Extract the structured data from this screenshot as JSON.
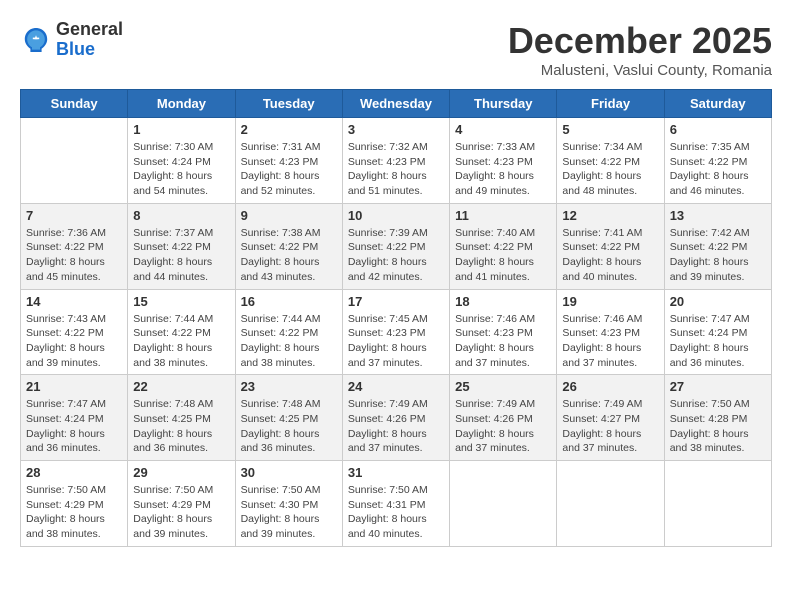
{
  "logo": {
    "general": "General",
    "blue": "Blue"
  },
  "header": {
    "month": "December 2025",
    "location": "Malusteni, Vaslui County, Romania"
  },
  "weekdays": [
    "Sunday",
    "Monday",
    "Tuesday",
    "Wednesday",
    "Thursday",
    "Friday",
    "Saturday"
  ],
  "weeks": [
    [
      {
        "day": "",
        "sunrise": "",
        "sunset": "",
        "daylight": ""
      },
      {
        "day": "1",
        "sunrise": "Sunrise: 7:30 AM",
        "sunset": "Sunset: 4:24 PM",
        "daylight": "Daylight: 8 hours and 54 minutes."
      },
      {
        "day": "2",
        "sunrise": "Sunrise: 7:31 AM",
        "sunset": "Sunset: 4:23 PM",
        "daylight": "Daylight: 8 hours and 52 minutes."
      },
      {
        "day": "3",
        "sunrise": "Sunrise: 7:32 AM",
        "sunset": "Sunset: 4:23 PM",
        "daylight": "Daylight: 8 hours and 51 minutes."
      },
      {
        "day": "4",
        "sunrise": "Sunrise: 7:33 AM",
        "sunset": "Sunset: 4:23 PM",
        "daylight": "Daylight: 8 hours and 49 minutes."
      },
      {
        "day": "5",
        "sunrise": "Sunrise: 7:34 AM",
        "sunset": "Sunset: 4:22 PM",
        "daylight": "Daylight: 8 hours and 48 minutes."
      },
      {
        "day": "6",
        "sunrise": "Sunrise: 7:35 AM",
        "sunset": "Sunset: 4:22 PM",
        "daylight": "Daylight: 8 hours and 46 minutes."
      }
    ],
    [
      {
        "day": "7",
        "sunrise": "Sunrise: 7:36 AM",
        "sunset": "Sunset: 4:22 PM",
        "daylight": "Daylight: 8 hours and 45 minutes."
      },
      {
        "day": "8",
        "sunrise": "Sunrise: 7:37 AM",
        "sunset": "Sunset: 4:22 PM",
        "daylight": "Daylight: 8 hours and 44 minutes."
      },
      {
        "day": "9",
        "sunrise": "Sunrise: 7:38 AM",
        "sunset": "Sunset: 4:22 PM",
        "daylight": "Daylight: 8 hours and 43 minutes."
      },
      {
        "day": "10",
        "sunrise": "Sunrise: 7:39 AM",
        "sunset": "Sunset: 4:22 PM",
        "daylight": "Daylight: 8 hours and 42 minutes."
      },
      {
        "day": "11",
        "sunrise": "Sunrise: 7:40 AM",
        "sunset": "Sunset: 4:22 PM",
        "daylight": "Daylight: 8 hours and 41 minutes."
      },
      {
        "day": "12",
        "sunrise": "Sunrise: 7:41 AM",
        "sunset": "Sunset: 4:22 PM",
        "daylight": "Daylight: 8 hours and 40 minutes."
      },
      {
        "day": "13",
        "sunrise": "Sunrise: 7:42 AM",
        "sunset": "Sunset: 4:22 PM",
        "daylight": "Daylight: 8 hours and 39 minutes."
      }
    ],
    [
      {
        "day": "14",
        "sunrise": "Sunrise: 7:43 AM",
        "sunset": "Sunset: 4:22 PM",
        "daylight": "Daylight: 8 hours and 39 minutes."
      },
      {
        "day": "15",
        "sunrise": "Sunrise: 7:44 AM",
        "sunset": "Sunset: 4:22 PM",
        "daylight": "Daylight: 8 hours and 38 minutes."
      },
      {
        "day": "16",
        "sunrise": "Sunrise: 7:44 AM",
        "sunset": "Sunset: 4:22 PM",
        "daylight": "Daylight: 8 hours and 38 minutes."
      },
      {
        "day": "17",
        "sunrise": "Sunrise: 7:45 AM",
        "sunset": "Sunset: 4:23 PM",
        "daylight": "Daylight: 8 hours and 37 minutes."
      },
      {
        "day": "18",
        "sunrise": "Sunrise: 7:46 AM",
        "sunset": "Sunset: 4:23 PM",
        "daylight": "Daylight: 8 hours and 37 minutes."
      },
      {
        "day": "19",
        "sunrise": "Sunrise: 7:46 AM",
        "sunset": "Sunset: 4:23 PM",
        "daylight": "Daylight: 8 hours and 37 minutes."
      },
      {
        "day": "20",
        "sunrise": "Sunrise: 7:47 AM",
        "sunset": "Sunset: 4:24 PM",
        "daylight": "Daylight: 8 hours and 36 minutes."
      }
    ],
    [
      {
        "day": "21",
        "sunrise": "Sunrise: 7:47 AM",
        "sunset": "Sunset: 4:24 PM",
        "daylight": "Daylight: 8 hours and 36 minutes."
      },
      {
        "day": "22",
        "sunrise": "Sunrise: 7:48 AM",
        "sunset": "Sunset: 4:25 PM",
        "daylight": "Daylight: 8 hours and 36 minutes."
      },
      {
        "day": "23",
        "sunrise": "Sunrise: 7:48 AM",
        "sunset": "Sunset: 4:25 PM",
        "daylight": "Daylight: 8 hours and 36 minutes."
      },
      {
        "day": "24",
        "sunrise": "Sunrise: 7:49 AM",
        "sunset": "Sunset: 4:26 PM",
        "daylight": "Daylight: 8 hours and 37 minutes."
      },
      {
        "day": "25",
        "sunrise": "Sunrise: 7:49 AM",
        "sunset": "Sunset: 4:26 PM",
        "daylight": "Daylight: 8 hours and 37 minutes."
      },
      {
        "day": "26",
        "sunrise": "Sunrise: 7:49 AM",
        "sunset": "Sunset: 4:27 PM",
        "daylight": "Daylight: 8 hours and 37 minutes."
      },
      {
        "day": "27",
        "sunrise": "Sunrise: 7:50 AM",
        "sunset": "Sunset: 4:28 PM",
        "daylight": "Daylight: 8 hours and 38 minutes."
      }
    ],
    [
      {
        "day": "28",
        "sunrise": "Sunrise: 7:50 AM",
        "sunset": "Sunset: 4:29 PM",
        "daylight": "Daylight: 8 hours and 38 minutes."
      },
      {
        "day": "29",
        "sunrise": "Sunrise: 7:50 AM",
        "sunset": "Sunset: 4:29 PM",
        "daylight": "Daylight: 8 hours and 39 minutes."
      },
      {
        "day": "30",
        "sunrise": "Sunrise: 7:50 AM",
        "sunset": "Sunset: 4:30 PM",
        "daylight": "Daylight: 8 hours and 39 minutes."
      },
      {
        "day": "31",
        "sunrise": "Sunrise: 7:50 AM",
        "sunset": "Sunset: 4:31 PM",
        "daylight": "Daylight: 8 hours and 40 minutes."
      },
      {
        "day": "",
        "sunrise": "",
        "sunset": "",
        "daylight": ""
      },
      {
        "day": "",
        "sunrise": "",
        "sunset": "",
        "daylight": ""
      },
      {
        "day": "",
        "sunrise": "",
        "sunset": "",
        "daylight": ""
      }
    ]
  ]
}
